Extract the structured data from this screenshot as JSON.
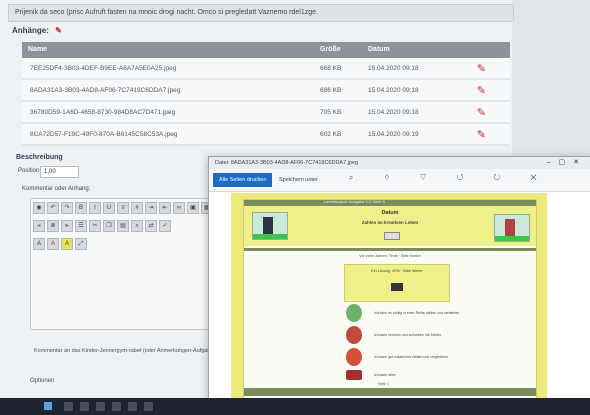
{
  "banner": {
    "text": "Prijenik da seco (prisc Aufruft fasten na mnoic drogi nacht. Omco si pregledatt Vaznemo rdel1zge."
  },
  "attachments": {
    "label": "Anhänge:",
    "edit_icon": "pencil-icon",
    "columns": [
      "Name",
      "Größe",
      "Datum"
    ],
    "rows": [
      {
        "name": "7EE25DF4-3B03-4DEF-B9EE-A6A7A5E0A25.jpeg",
        "size": "668 KB",
        "date": "15.04.2020 09:18"
      },
      {
        "name": "8ADA31A3-3B03-4AD8-AF06-7C7419C6DDA7.jpeg",
        "size": "686 KB",
        "date": "15.04.2020 09:18"
      },
      {
        "name": "36780D59-1A6D-4658-8730-984D8AC7D471.jpeg",
        "size": "705 KB",
        "date": "15.04.2020 09:18"
      },
      {
        "name": "8CA72D57-F19C-49F0-870A-B6145C58C53A.jpeg",
        "size": "602 KB",
        "date": "15.04.2020 09:19"
      }
    ]
  },
  "form": {
    "description_label": "Beschreibung",
    "position_label": "Position",
    "position_value": "1,00",
    "comment_label": "Kommentar oder Anhang:"
  },
  "footnote": "Kommentar an das Kinder-Jennergym-rabet (oder Anmerkungen-Aufgaben-Eingabe)",
  "options_label": "Optionen",
  "popup": {
    "title": "Datei: 8ADA31A3-3B03-4AD8-AF06-7C7419C6DDA7.jpeg",
    "print_label": "Alle Seiten drucken",
    "save_label": "Speichern unter",
    "doc": {
      "topbar": "Lernsituation: Ausgabe 1.0 Seite 5",
      "title": "Datum",
      "subtitle": "Zahlen im kreativen Leben",
      "small_line": "Vor zehn Jahren: Texte · Bitte Weiter",
      "box_text": "Ein Lösung: 40% · Bitte Weiter",
      "items": [
        {
          "text": "Ich kann es richtig in einer Reihe zählen und verstehen."
        },
        {
          "text": "Ich kann rechnen und schreiben mit Zahlen."
        },
        {
          "text": "Ich kann gut zusammen zählen und vergleichen."
        },
        {
          "text": "Ich kann alles."
        }
      ],
      "page_label": "Seite 1"
    }
  },
  "colors": {
    "accent_red": "#c02b2b",
    "doc_yellow": "#ecea7f",
    "print_blue": "#1e6bc4"
  }
}
